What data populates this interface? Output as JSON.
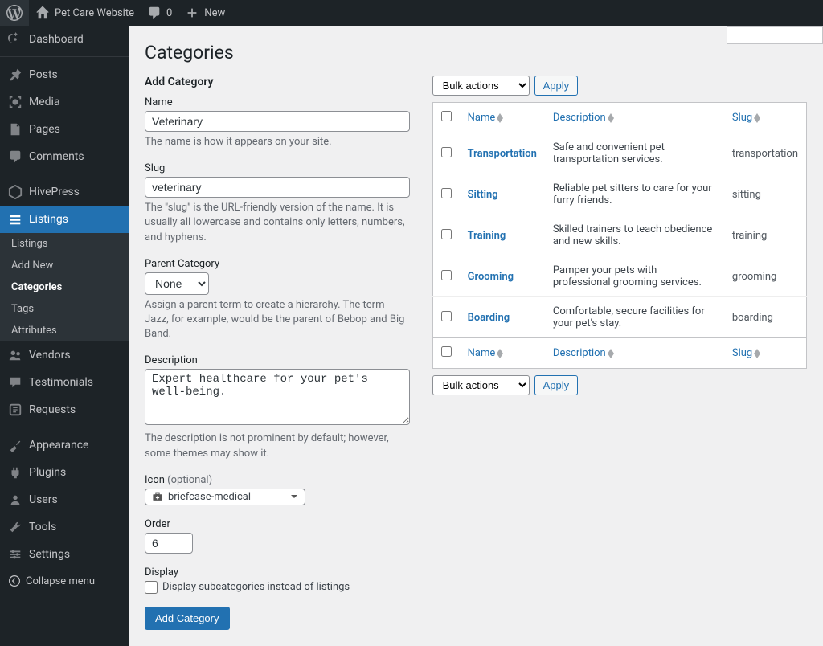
{
  "topbar": {
    "site_name": "Pet Care Website",
    "comments_count": "0",
    "new_label": "New"
  },
  "sidebar": {
    "dashboard": "Dashboard",
    "posts": "Posts",
    "media": "Media",
    "pages": "Pages",
    "comments": "Comments",
    "hivepress": "HivePress",
    "listings": "Listings",
    "listings_sub": {
      "listings": "Listings",
      "add_new": "Add New",
      "categories": "Categories",
      "tags": "Tags",
      "attributes": "Attributes"
    },
    "vendors": "Vendors",
    "testimonials": "Testimonials",
    "requests": "Requests",
    "appearance": "Appearance",
    "plugins": "Plugins",
    "users": "Users",
    "tools": "Tools",
    "settings": "Settings",
    "collapse": "Collapse menu"
  },
  "page": {
    "title": "Categories",
    "add_heading": "Add Category"
  },
  "form": {
    "name_label": "Name",
    "name_value": "Veterinary",
    "name_help": "The name is how it appears on your site.",
    "slug_label": "Slug",
    "slug_value": "veterinary",
    "slug_help": "The \"slug\" is the URL-friendly version of the name. It is usually all lowercase and contains only letters, numbers, and hyphens.",
    "parent_label": "Parent Category",
    "parent_value": "None",
    "parent_help": "Assign a parent term to create a hierarchy. The term Jazz, for example, would be the parent of Bebop and Big Band.",
    "description_label": "Description",
    "description_value": "Expert healthcare for your pet's well-being.",
    "description_help": "The description is not prominent by default; however, some themes may show it.",
    "icon_label": "Icon",
    "icon_optional": "(optional)",
    "icon_value": "briefcase-medical",
    "order_label": "Order",
    "order_value": "6",
    "display_label": "Display",
    "display_checkbox_label": "Display subcategories instead of listings",
    "submit_label": "Add Category"
  },
  "table": {
    "bulk_actions": "Bulk actions",
    "apply": "Apply",
    "headers": {
      "name": "Name",
      "description": "Description",
      "slug": "Slug"
    },
    "rows": [
      {
        "name": "Transportation",
        "description": "Safe and convenient pet transportation services.",
        "slug": "transportation"
      },
      {
        "name": "Sitting",
        "description": "Reliable pet sitters to care for your furry friends.",
        "slug": "sitting"
      },
      {
        "name": "Training",
        "description": "Skilled trainers to teach obedience and new skills.",
        "slug": "training"
      },
      {
        "name": "Grooming",
        "description": "Pamper your pets with professional grooming services.",
        "slug": "grooming"
      },
      {
        "name": "Boarding",
        "description": "Comfortable, secure facilities for your pet's stay.",
        "slug": "boarding"
      }
    ]
  }
}
